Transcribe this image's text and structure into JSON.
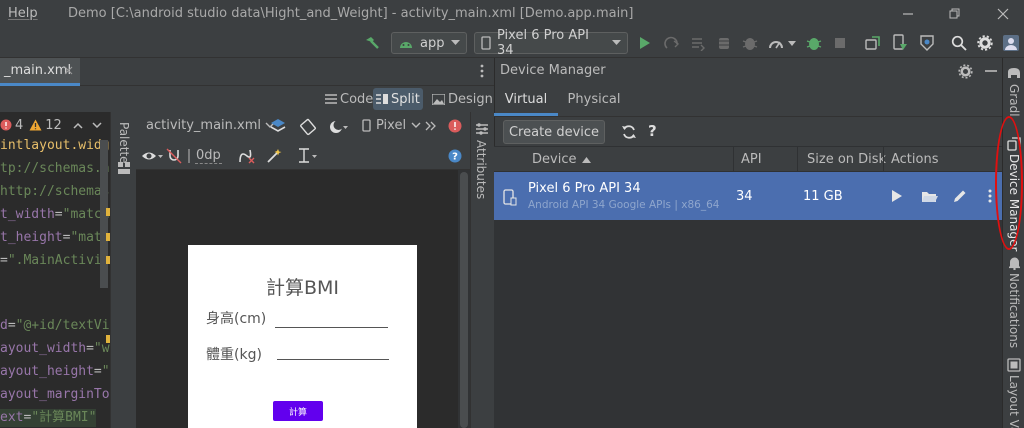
{
  "titlebar": {
    "menu_help": "Help",
    "title": "Demo [C:\\android studio data\\Hight_and_Weight] - activity_main.xml [Demo.app.main]"
  },
  "toolbar": {
    "run_config": "app",
    "device": "Pixel 6 Pro API 34"
  },
  "editor": {
    "tab_label": "_main.xml",
    "views": {
      "code": "Code",
      "split": "Split",
      "design": "Design"
    },
    "inspections": {
      "errors": "4",
      "warnings": "12"
    },
    "code_lines": [
      {
        "parts": [
          {
            "t": "intlayout.widg",
            "c": "k"
          }
        ]
      },
      {
        "parts": [
          {
            "t": "tp://schemas.a",
            "c": "v"
          }
        ]
      },
      {
        "parts": [
          {
            "t": "http://schemas",
            "c": "v"
          }
        ]
      },
      {
        "parts": [
          {
            "t": "t_width",
            "c": "n"
          },
          {
            "t": "=",
            "c": "a"
          },
          {
            "t": "\"match",
            "c": "v"
          }
        ]
      },
      {
        "parts": [
          {
            "t": "t_height",
            "c": "n"
          },
          {
            "t": "=",
            "c": "a"
          },
          {
            "t": "\"matc",
            "c": "v"
          }
        ]
      },
      {
        "parts": [
          {
            "t": "=",
            "c": "a"
          },
          {
            "t": "\".MainActivit",
            "c": "v"
          }
        ]
      },
      {
        "parts": []
      },
      {
        "parts": []
      },
      {
        "parts": [
          {
            "t": "d",
            "c": "n"
          },
          {
            "t": "=",
            "c": "a"
          },
          {
            "t": "\"@+id/textVi",
            "c": "v"
          }
        ]
      },
      {
        "parts": [
          {
            "t": "ayout_width",
            "c": "n"
          },
          {
            "t": "=",
            "c": "a"
          },
          {
            "t": "\"w",
            "c": "v"
          }
        ]
      },
      {
        "parts": [
          {
            "t": "ayout_height",
            "c": "n"
          },
          {
            "t": "=",
            "c": "a"
          },
          {
            "t": "\"",
            "c": "v"
          }
        ]
      },
      {
        "parts": [
          {
            "t": "ayout_marginTo",
            "c": "n"
          }
        ]
      },
      {
        "parts": [
          {
            "t": "ext",
            "c": "n"
          },
          {
            "t": "=",
            "c": "a"
          },
          {
            "t": "\"計算BMI\"",
            "c": "v"
          }
        ]
      }
    ]
  },
  "design": {
    "file_selector": "activity_main.xml",
    "device_selector": "Pixel",
    "margin_value": "0dp",
    "palette_label": "Palette",
    "attributes_label": "Attributes",
    "preview": {
      "title": "計算BMI",
      "height_label": "身高(cm)",
      "weight_label": "體重(kg)",
      "button_label": "計算"
    }
  },
  "device_manager": {
    "title": "Device Manager",
    "tabs": [
      "Virtual",
      "Physical"
    ],
    "create_device_label": "Create device",
    "help_label": "?",
    "columns": {
      "device": "Device",
      "api": "API",
      "size": "Size on Disk",
      "actions": "Actions"
    },
    "rows": [
      {
        "name": "Pixel 6 Pro API 34",
        "detail": "Android API 34 Google APIs | x86_64",
        "api": "34",
        "size": "11 GB"
      }
    ]
  },
  "right_strip": {
    "gradle": "Gradle",
    "device_manager": "Device Manager",
    "notifications": "Notifications",
    "layout_validation": "Layout Vali"
  },
  "colors": {
    "accent_selected_row": "#4b6eaf",
    "run_green": "#59a869",
    "preview_button": "#6200ee",
    "annotation_red": "#e01010"
  }
}
